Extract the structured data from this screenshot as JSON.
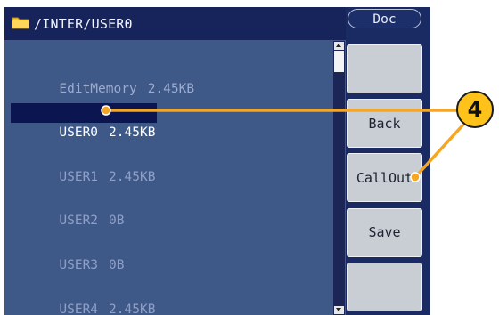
{
  "header": {
    "path": "/INTER/USER0",
    "folder_icon": "folder-icon"
  },
  "files": [
    {
      "name": "EditMemory",
      "size": "2.45KB"
    },
    {
      "name": "USER0",
      "size": "2.45KB",
      "selected": true
    },
    {
      "name": "USER1",
      "size": "2.45KB"
    },
    {
      "name": "USER2",
      "size": "0B"
    },
    {
      "name": "USER3",
      "size": "0B"
    },
    {
      "name": "USER4",
      "size": "2.45KB"
    }
  ],
  "menu": {
    "title": "Doc",
    "softkeys": [
      "",
      "Back",
      "CallOut",
      "Save",
      ""
    ]
  },
  "callout": {
    "number": "4",
    "color": "#f5a623"
  },
  "colors": {
    "screen": "#3e5887",
    "titlebar": "#17245b",
    "selection": "#0b1650",
    "softkey": "#c9ced5"
  }
}
